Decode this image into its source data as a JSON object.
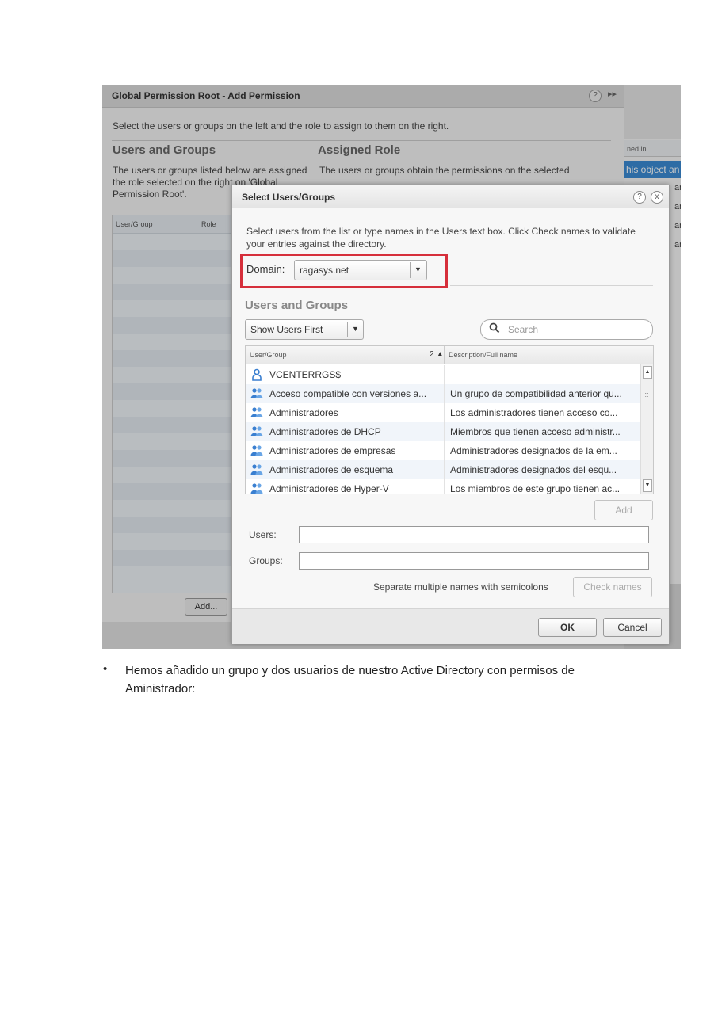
{
  "background_window": {
    "title": "Global Permission Root - Add Permission",
    "help": "?",
    "expand": "▸▸",
    "instructions": "Select the users or groups on the left and the role to assign to them on the right.",
    "users_groups_title": "Users and Groups",
    "users_groups_desc": "The users or groups listed below are assigned the role selected on the right on 'Global Permission Root'.",
    "assigned_role_title": "Assigned Role",
    "assigned_role_desc": "The users or groups obtain the permissions on the selected",
    "table_columns": [
      "User/Group",
      "Role"
    ],
    "add_button": "Add..."
  },
  "right_panel": {
    "header": "ned in",
    "selected_text": "his object an",
    "fragments": [
      "an",
      "an",
      "an",
      "an"
    ]
  },
  "dialog": {
    "title": "Select Users/Groups",
    "help": "?",
    "close": "x",
    "instructions": "Select users from the list or type names in the Users text box. Click Check names to validate your entries against the directory.",
    "domain_label": "Domain:",
    "domain_value": "ragasys.net",
    "users_groups_title": "Users and Groups",
    "sort_value": "Show Users First",
    "search_placeholder": "Search",
    "list": {
      "col_user_group": "User/Group",
      "sort_indicator": "2 ▲",
      "col_description": "Description/Full name",
      "rows": [
        {
          "name": "VCENTERRGS$",
          "desc": "",
          "type": "user"
        },
        {
          "name": "Acceso compatible con versiones a...",
          "desc": "Un grupo de compatibilidad anterior qu...",
          "type": "group"
        },
        {
          "name": "Administradores",
          "desc": "Los administradores tienen acceso co...",
          "type": "group"
        },
        {
          "name": "Administradores de DHCP",
          "desc": "Miembros que tienen acceso administr...",
          "type": "group"
        },
        {
          "name": "Administradores de empresas",
          "desc": "Administradores designados de la em...",
          "type": "group"
        },
        {
          "name": "Administradores de esquema",
          "desc": "Administradores designados del esqu...",
          "type": "group"
        },
        {
          "name": "Administradores de Hyper-V",
          "desc": "Los miembros de este grupo tienen ac...",
          "type": "group"
        }
      ]
    },
    "add_button": "Add",
    "users_label": "Users:",
    "groups_label": "Groups:",
    "separator_hint": "Separate multiple names with semicolons",
    "check_names_button": "Check names",
    "ok_button": "OK",
    "cancel_button": "Cancel"
  },
  "document": {
    "bullet": "•",
    "text": "Hemos añadido un grupo y dos usuarios de nuestro Active Directory con permisos de Aministrador:"
  },
  "colors": {
    "highlight": "#d62f3b",
    "selection": "#3b8bd4",
    "user_icon": "#3a7fd0",
    "group_icon": "#3a7fd0"
  }
}
